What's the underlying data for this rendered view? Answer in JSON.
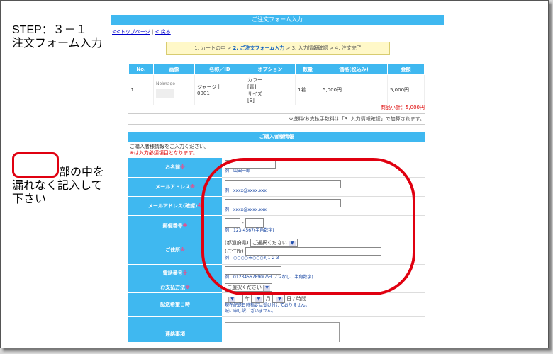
{
  "step": {
    "line1": "STEP：３－１",
    "line2": "注文フォーム入力"
  },
  "note": {
    "line1": "部の中を",
    "line2": "漏れなく記入して",
    "line3": "下さい"
  },
  "page": {
    "title": "ご注文フォーム入力",
    "links": {
      "top": "<<トップページ",
      "sep": "|",
      "back": "< 戻る"
    },
    "steps": {
      "s1": "1. カートの中 > ",
      "s2": "2. ご注文フォーム入力",
      "s3": " > 3. 入力情報確認 > 4. 注文完了"
    },
    "table": {
      "headers": [
        "No.",
        "画像",
        "名称／ID",
        "オプション",
        "数量",
        "価格(税込み)",
        "金額"
      ],
      "row": {
        "no": "1",
        "image": "NoImage",
        "name": "ジャージ上",
        "id": "0001",
        "opt1": "カラー",
        "opt2": "[青]",
        "opt3": "サイズ",
        "opt4": "[S]",
        "qty": "1着",
        "price": "5,000円",
        "amount": "5,000円"
      }
    },
    "subtotal": "商品小計：5,000円",
    "shipnote": "※送料/お支払手数料は「3. 入力情報確認」で加算されます。",
    "buyer": {
      "title": "ご購入者様情報",
      "intro1": "ご購入者様情報をご入力ください。",
      "intro2": "※は入力必須項目となります。"
    },
    "form": {
      "asterisk": "※",
      "name_label": "お名前",
      "name_hint": "例：山田一郎",
      "email_label": "メールアドレス",
      "email_hint": "例：xxxx@xxxx.xxx",
      "email2_label": "メールアドレス(確認)",
      "email2_hint": "例：xxxx@xxxx.xxx",
      "zip_label": "郵便番号",
      "zip_dash": "-",
      "zip_hint": "例：123-4567(半角数字)",
      "addr_label": "ご住所",
      "pref_prefix": "(都道府県)",
      "pref_select": "ご選択ください",
      "addr_prefix": "(ご住所)",
      "addr_hint": "例：○○○○市○○○町1-2-3",
      "tel_label": "電話番号",
      "tel_hint": "例：01234567890(ハイフンなし、半角数字)",
      "pay_label": "お支払方法",
      "pay_select": "ご選択ください",
      "date_label": "配送希望日時",
      "year": "年",
      "month": "月",
      "day_time": "日 / 時間",
      "date_note1": "現在配送日時指定は受け付けておりません。",
      "date_note2": "誠に申し訳ございません。",
      "msg_label": "連絡事項"
    }
  }
}
